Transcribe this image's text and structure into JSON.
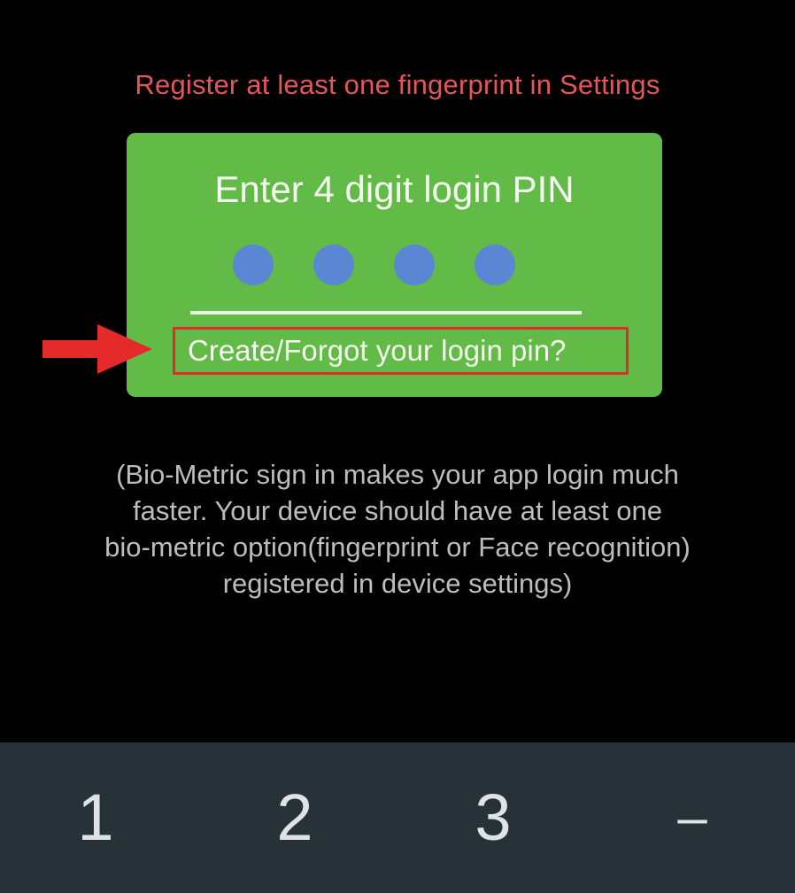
{
  "header": {
    "warning_text": "Register at least one fingerprint in Settings"
  },
  "pin_card": {
    "title": "Enter 4 digit login PIN",
    "digit_count": 4,
    "forgot_link": "Create/Forgot your login pin?"
  },
  "info": {
    "lines": [
      "(Bio-Metric sign in makes your app login much",
      "faster. Your device should have at least one",
      "bio-metric option(fingerprint or Face recognition)",
      "registered in device settings)"
    ]
  },
  "keypad": {
    "keys": [
      "1",
      "2",
      "3",
      "–"
    ]
  },
  "colors": {
    "background": "#000000",
    "warning": "#e5565a",
    "card": "#62bb47",
    "pin_dot": "#5b86d3",
    "highlight": "#e42a2a",
    "keypad": "#263238"
  }
}
